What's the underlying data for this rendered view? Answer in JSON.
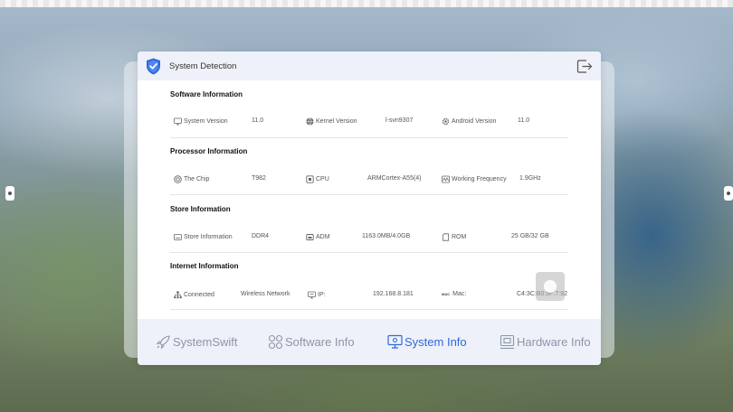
{
  "window": {
    "title": "System Detection"
  },
  "sections": [
    {
      "title": "Software Information",
      "items": [
        {
          "icon": "monitor-icon",
          "label": "System Version",
          "value": "11.0"
        },
        {
          "icon": "globe-icon",
          "label": "Kernel Version",
          "value": "l-svn9307"
        },
        {
          "icon": "android-gear-icon",
          "label": "Android Version",
          "value": "11.0"
        }
      ]
    },
    {
      "title": "Processor Information",
      "items": [
        {
          "icon": "chip-circle-icon",
          "label": "The Chip",
          "value": "T982"
        },
        {
          "icon": "cpu-icon",
          "label": "CPU",
          "value": "ARMCortex-A55(4)"
        },
        {
          "icon": "frequency-wave-icon",
          "label": "Working Frequency",
          "value": "1.9GHz"
        }
      ]
    },
    {
      "title": "Store Information",
      "items": [
        {
          "icon": "storage-icon",
          "label": "Store Information",
          "value": "DDR4"
        },
        {
          "icon": "ram-icon",
          "label": "ADM",
          "value": "1163.0MB/4.0GB"
        },
        {
          "icon": "rom-card-icon",
          "label": "ROM",
          "value": "25 GB/32 GB"
        }
      ]
    },
    {
      "title": "Internet Information",
      "items": [
        {
          "icon": "network-tree-icon",
          "label": "Connected",
          "value": "Wireless Network"
        },
        {
          "icon": "ip-icon",
          "label": "IP:",
          "value": "192.168.8.181"
        },
        {
          "icon": "mac-icon",
          "label": "Mac:",
          "value": "C4:3C:B0:9F:7:92",
          "icon_text": "MAC"
        }
      ]
    }
  ],
  "bottom_nav": [
    {
      "label": "SystemSwift",
      "icon": "rocket-icon",
      "active": false
    },
    {
      "label": "Software Info",
      "icon": "apps-grid-icon",
      "active": false
    },
    {
      "label": "System Info",
      "icon": "system-monitor-icon",
      "active": true
    },
    {
      "label": "Hardware Info",
      "icon": "hardware-icon",
      "active": false
    }
  ],
  "colors": {
    "accent": "#2f68d8",
    "inactive_nav": "#8c96a8",
    "header_bg": "#eef1f9"
  }
}
